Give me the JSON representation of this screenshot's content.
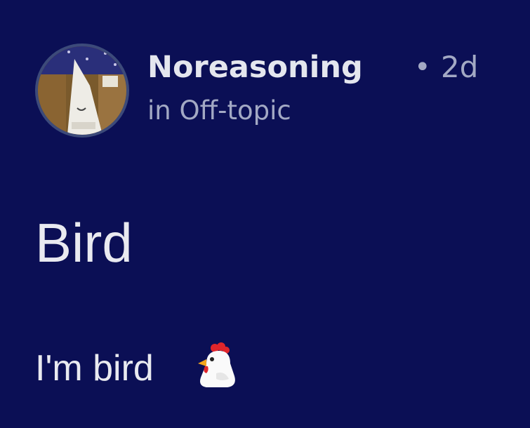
{
  "post": {
    "author": "Noreasoning",
    "separator": "•",
    "age": "2d",
    "community_prefix": "in",
    "community": "Off-topic",
    "title": "Bird",
    "body": "I'm bird",
    "body_emoji": "chicken-icon"
  },
  "colors": {
    "background": "#0b0f55",
    "primary_text": "#e4e6ee",
    "secondary_text": "#a3a9c4",
    "avatar_ring": "#3c4a7a"
  }
}
